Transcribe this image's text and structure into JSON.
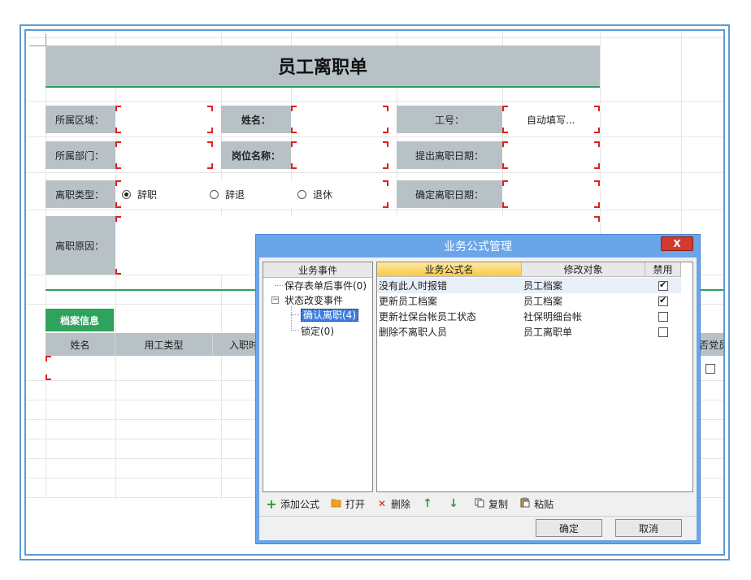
{
  "form": {
    "title": "员工离职单",
    "labels": {
      "region": "所属区域：",
      "name": "姓名：",
      "emp_no": "工号：",
      "dept": "所属部门：",
      "position": "岗位名称：",
      "apply_date": "提出离职日期：",
      "type": "离职类型：",
      "confirm_date": "确定离职日期：",
      "reason": "离职原因："
    },
    "emp_no_value": "自动填写...",
    "types": [
      {
        "label": "辞职",
        "selected": true
      },
      {
        "label": "辞退",
        "selected": false
      },
      {
        "label": "退休",
        "selected": false
      }
    ]
  },
  "archive": {
    "tab": "档案信息",
    "columns": [
      "姓名",
      "用工类型",
      "入职时"
    ],
    "partial_right_header": "否党员"
  },
  "dialog": {
    "title": "业务公式管理",
    "close": "X",
    "tree_header": "业务事件",
    "tree": {
      "item1": "保存表单后事件(0)",
      "item2": "状态改变事件",
      "child1": "确认离职(4)",
      "child2": "锁定(0)",
      "expand_sign": "−"
    },
    "list_headers": {
      "name": "业务公式名",
      "target": "修改对象",
      "disabled": "禁用"
    },
    "rows": [
      {
        "name": "没有此人时报错",
        "target": "员工档案",
        "disabled": true
      },
      {
        "name": "更新员工档案",
        "target": "员工档案",
        "disabled": true
      },
      {
        "name": "更新社保台帐员工状态",
        "target": "社保明细台帐",
        "disabled": false
      },
      {
        "name": "删除不离职人员",
        "target": "员工离职单",
        "disabled": false
      }
    ],
    "toolbar": {
      "add": "添加公式",
      "open": "打开",
      "delete": "删除",
      "up_icon": "↑",
      "down_icon": "↓",
      "copy": "复制",
      "paste": "粘贴",
      "add_icon": "+",
      "delete_icon": "✕"
    },
    "ok": "确定",
    "cancel": "取消"
  },
  "colors": {
    "frame": "#5b9bd5",
    "label_bg": "#b8c2c6",
    "accent_green": "#2ea35c",
    "dialog_blue": "#6aa5ea",
    "required_red": "#e02020"
  }
}
